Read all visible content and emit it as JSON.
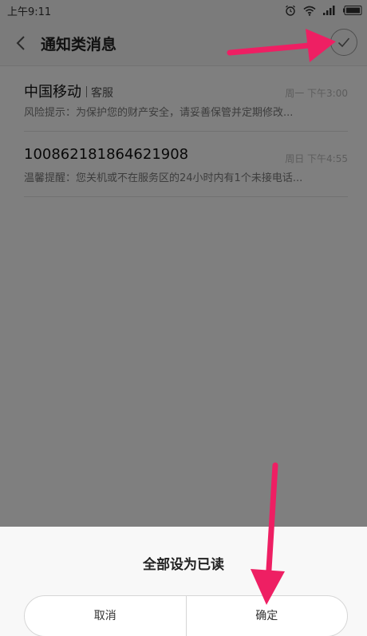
{
  "status_bar": {
    "time": "上午9:11",
    "icons": [
      "alarm-icon",
      "wifi-icon",
      "signal-icon",
      "battery-icon"
    ]
  },
  "header": {
    "back_icon": "chevron-left-icon",
    "title": "通知类消息",
    "mark_all_icon": "checkmark-circle-icon"
  },
  "messages": [
    {
      "sender": "中国移动",
      "tag": "客服",
      "time": "周一 下午3:00",
      "preview": "风险提示：为保护您的财产安全，请妥善保管并定期修改..."
    },
    {
      "sender": "10086218186462190​8",
      "tag": "",
      "time": "周日 下午4:55",
      "preview": "温馨提醒：您关机或不在服务区的24小时内有1个未接电话..."
    }
  ],
  "dialog": {
    "title": "全部设为已读",
    "cancel_label": "取消",
    "confirm_label": "确定"
  },
  "annotations": {
    "arrow_color": "#ee1f63"
  }
}
